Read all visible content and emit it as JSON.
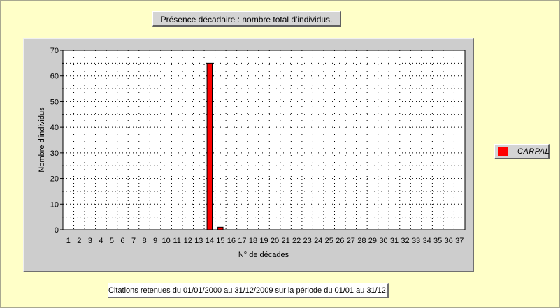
{
  "chart_data": {
    "type": "bar",
    "title": "Présence décadaire : nombre total d'individus.",
    "xlabel": "N° de décades",
    "ylabel": "Nombre d'individus",
    "ylim": [
      0,
      70
    ],
    "yticks": [
      0,
      10,
      20,
      30,
      40,
      50,
      60,
      70
    ],
    "grid": true,
    "legend_position": "right",
    "categories": [
      "1",
      "2",
      "3",
      "4",
      "5",
      "6",
      "7",
      "8",
      "9",
      "10",
      "11",
      "12",
      "13",
      "14",
      "15",
      "16",
      "17",
      "18",
      "19",
      "20",
      "21",
      "22",
      "23",
      "24",
      "25",
      "26",
      "27",
      "28",
      "29",
      "30",
      "31",
      "32",
      "33",
      "34",
      "35",
      "36",
      "37"
    ],
    "series": [
      {
        "name": "CARPAL",
        "color": "#ff0000",
        "values": [
          0,
          0,
          0,
          0,
          0,
          0,
          0,
          0,
          0,
          0,
          0,
          0,
          0,
          65,
          1,
          0,
          0,
          0,
          0,
          0,
          0,
          0,
          0,
          0,
          0,
          0,
          0,
          0,
          0,
          0,
          0,
          0,
          0,
          0,
          0,
          0,
          0
        ]
      }
    ]
  },
  "footer": {
    "text": "Citations retenues du 01/01/2000 au 31/12/2009 sur la période du 01/01 au 31/12."
  },
  "colors": {
    "background": "#ffffc8",
    "panel": "#cdcdcd",
    "plot_area": "#ffffff",
    "bar": "#ff0000"
  }
}
